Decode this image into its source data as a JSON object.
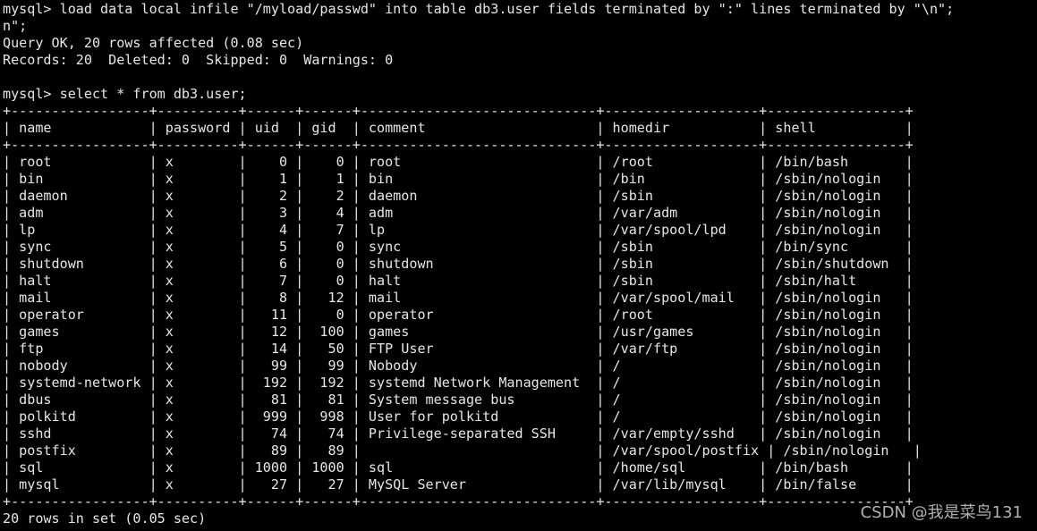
{
  "terminal": {
    "lines": [
      "mysql> load data local infile \"/myload/passwd\" into table db3.user fields terminated by \":\" lines terminated by \"\\n\";",
      "n\";",
      "Query OK, 20 rows affected (0.08 sec)",
      "Records: 20  Deleted: 0  Skipped: 0  Warnings: 0",
      "",
      "mysql> select * from db3.user;",
      "+-----------------+----------+------+------+-----------------------------+-------------------+-----------------+",
      "| name            | password | uid  | gid  | comment                     | homedir           | shell           |",
      "+-----------------+----------+------+------+-----------------------------+-------------------+-----------------+",
      "| root            | x        |    0 |    0 | root                        | /root             | /bin/bash       |",
      "| bin             | x        |    1 |    1 | bin                         | /bin              | /sbin/nologin   |",
      "| daemon          | x        |    2 |    2 | daemon                      | /sbin             | /sbin/nologin   |",
      "| adm             | x        |    3 |    4 | adm                         | /var/adm          | /sbin/nologin   |",
      "| lp              | x        |    4 |    7 | lp                          | /var/spool/lpd    | /sbin/nologin   |",
      "| sync            | x        |    5 |    0 | sync                        | /sbin             | /bin/sync       |",
      "| shutdown        | x        |    6 |    0 | shutdown                    | /sbin             | /sbin/shutdown  |",
      "| halt            | x        |    7 |    0 | halt                        | /sbin             | /sbin/halt      |",
      "| mail            | x        |    8 |   12 | mail                        | /var/spool/mail   | /sbin/nologin   |",
      "| operator        | x        |   11 |    0 | operator                    | /root             | /sbin/nologin   |",
      "| games           | x        |   12 |  100 | games                       | /usr/games        | /sbin/nologin   |",
      "| ftp             | x        |   14 |   50 | FTP User                    | /var/ftp          | /sbin/nologin   |",
      "| nobody          | x        |   99 |   99 | Nobody                      | /                 | /sbin/nologin   |",
      "| systemd-network | x        |  192 |  192 | systemd Network Management  | /                 | /sbin/nologin   |",
      "| dbus            | x        |   81 |   81 | System message bus          | /                 | /sbin/nologin   |",
      "| polkitd         | x        |  999 |  998 | User for polkitd            | /                 | /sbin/nologin   |",
      "| sshd            | x        |   74 |   74 | Privilege-separated SSH     | /var/empty/sshd   | /sbin/nologin   |",
      "| postfix         | x        |   89 |   89 |                             | /var/spool/postfix | /sbin/nologin   |",
      "| sql             | x        | 1000 | 1000 | sql                         | /home/sql         | /bin/bash       |",
      "| mysql           | x        |   27 |   27 | MySQL Server                | /var/lib/mysql    | /bin/false      |",
      "+-----------------+----------+------+------+-----------------------------+-------------------+-----------------+",
      "20 rows in set (0.05 sec)"
    ]
  },
  "watermark": {
    "text": "CSDN @我是菜鸟131"
  },
  "colors": {
    "background": "#000000",
    "foreground": "#e6e6e6"
  }
}
